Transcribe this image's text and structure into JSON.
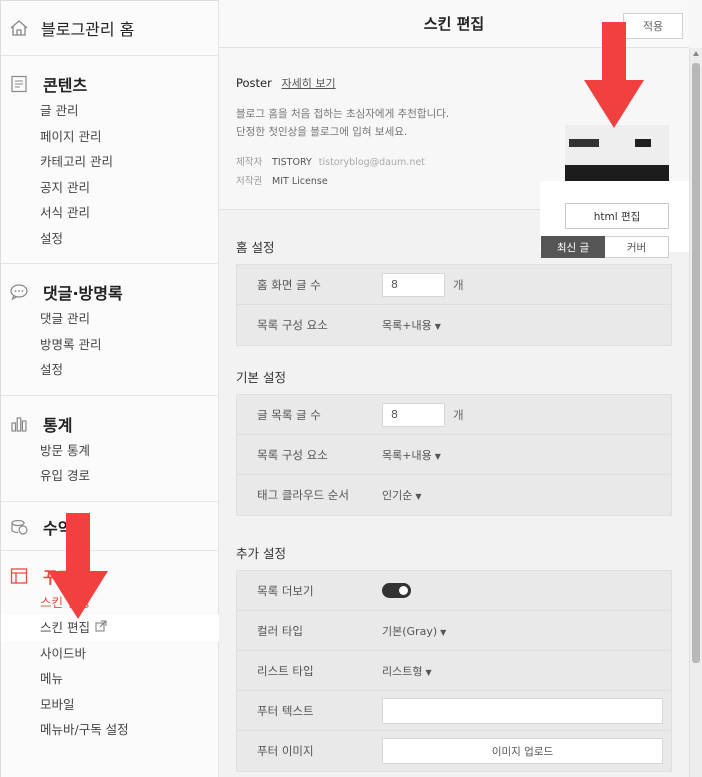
{
  "sidebar": {
    "home_label": "블로그관리 홈",
    "sections": [
      {
        "title": "콘텐츠",
        "icon": "document-icon",
        "items": [
          "글 관리",
          "페이지 관리",
          "카테고리 관리",
          "공지 관리",
          "서식 관리",
          "설정"
        ]
      },
      {
        "title": "댓글·방명록",
        "icon": "speech-bubble-icon",
        "items": [
          "댓글 관리",
          "방명록 관리",
          "설정"
        ]
      },
      {
        "title": "통계",
        "icon": "bar-chart-icon",
        "items": [
          "방문 통계",
          "유입 경로"
        ]
      },
      {
        "title": "수익",
        "icon": "coin-icon",
        "items": []
      },
      {
        "title": "꾸미기",
        "icon": "layout-icon",
        "items": [
          "스킨 변경",
          "스킨 편집",
          "사이드바",
          "메뉴",
          "모바일",
          "메뉴바/구독 설정"
        ]
      }
    ]
  },
  "header": {
    "title": "스킨 편집",
    "apply_label": "적용"
  },
  "skin": {
    "name": "Poster",
    "detail_link": "자세히 보기",
    "desc_line1": "블로그 홈을 처음 접하는 초심자에게 추천합니다.",
    "desc_line2": "단정한 첫인상을 블로그에 입혀 보세요.",
    "maker_label": "제작자",
    "maker_value": "TISTORY",
    "maker_email": "tistoryblog@daum.net",
    "license_label": "저작권",
    "license_value": "MIT License",
    "html_edit_label": "html 편집"
  },
  "home_settings": {
    "title": "홈 설정",
    "tabs": [
      "최신 글",
      "커버"
    ],
    "post_count_label": "홈 화면 글 수",
    "post_count_value": "8",
    "unit": "개",
    "list_elements_label": "목록 구성 요소",
    "list_elements_value": "목록+내용"
  },
  "basic_settings": {
    "title": "기본 설정",
    "post_count_label": "글 목록 글 수",
    "post_count_value": "8",
    "unit": "개",
    "list_elements_label": "목록 구성 요소",
    "list_elements_value": "목록+내용",
    "tag_cloud_label": "태그 클라우드 순서",
    "tag_cloud_value": "인기순"
  },
  "extra_settings": {
    "title": "추가 설정",
    "more_label": "목록 더보기",
    "color_type_label": "컬러 타입",
    "color_type_value": "기본(Gray)",
    "list_type_label": "리스트 타입",
    "list_type_value": "리스트형",
    "footer_text_label": "푸터 텍스트",
    "footer_image_label": "푸터 이미지",
    "upload_label": "이미지 업로드"
  },
  "colors": {
    "accent": "#e84c3d",
    "arrow": "#f24040"
  }
}
